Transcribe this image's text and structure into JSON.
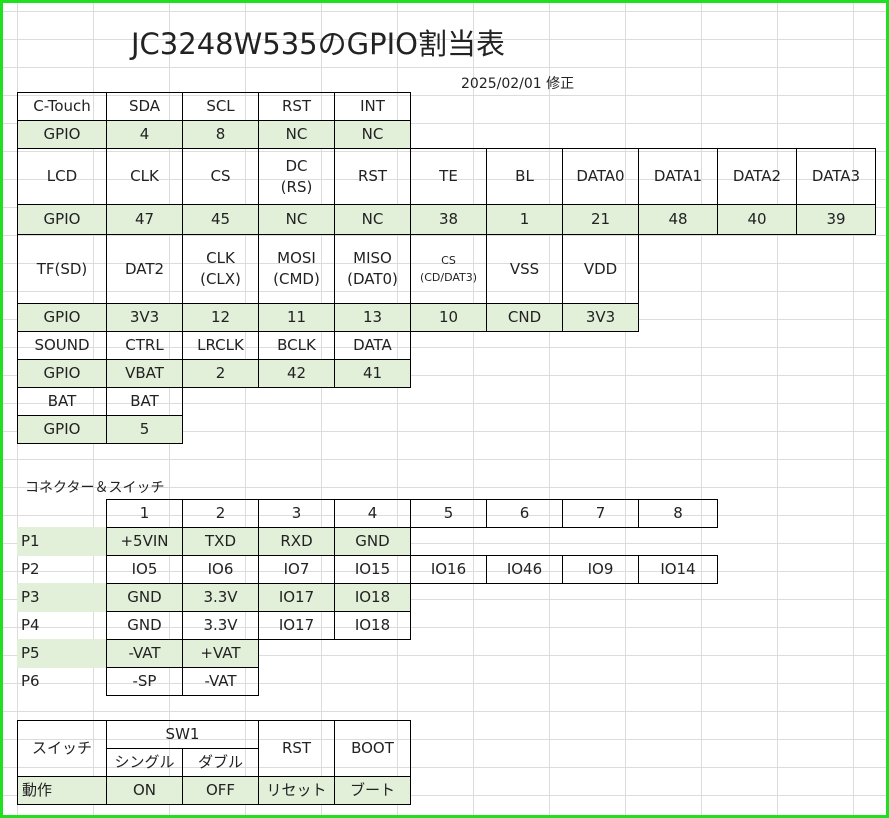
{
  "title": "JC3248W535のGPIO割当表",
  "date": "2025/02/01 修正",
  "touch": {
    "header": [
      "C-Touch",
      "SDA",
      "SCL",
      "RST",
      "INT"
    ],
    "gpio": [
      "GPIO",
      "4",
      "8",
      "NC",
      "NC"
    ]
  },
  "lcd": {
    "header": [
      "LCD",
      "CLK",
      "CS",
      "DC",
      "(RS)",
      "RST",
      "TE",
      "BL",
      "DATA0",
      "DATA1",
      "DATA2",
      "DATA3"
    ],
    "gpio": [
      "GPIO",
      "47",
      "45",
      "NC",
      "NC",
      "38",
      "1",
      "21",
      "48",
      "40",
      "39"
    ]
  },
  "tf": {
    "header": [
      "TF(SD)",
      "DAT2",
      "CLK",
      "(CLX)",
      "MOSI",
      "(CMD)",
      "MISO",
      "(DAT0)",
      "CS",
      "(CD/DAT3)",
      "VSS",
      "VDD"
    ],
    "gpio": [
      "GPIO",
      "3V3",
      "12",
      "11",
      "13",
      "10",
      "CND",
      "3V3"
    ]
  },
  "sound": {
    "header": [
      "SOUND",
      "CTRL",
      "LRCLK",
      "BCLK",
      "DATA"
    ],
    "gpio": [
      "GPIO",
      "VBAT",
      "2",
      "42",
      "41"
    ]
  },
  "bat": {
    "header": [
      "BAT",
      "BAT"
    ],
    "gpio": [
      "GPIO",
      "5"
    ]
  },
  "connector_label": "コネクター＆スイッチ",
  "connectors": {
    "numbers": [
      "1",
      "2",
      "3",
      "4",
      "5",
      "6",
      "7",
      "8"
    ],
    "rows": [
      {
        "name": "P1",
        "pins": [
          "+5VIN",
          "TXD",
          "RXD",
          "GND"
        ]
      },
      {
        "name": "P2",
        "pins": [
          "IO5",
          "IO6",
          "IO7",
          "IO15",
          "IO16",
          "IO46",
          "IO9",
          "IO14"
        ]
      },
      {
        "name": "P3",
        "pins": [
          "GND",
          "3.3V",
          "IO17",
          "IO18"
        ]
      },
      {
        "name": "P4",
        "pins": [
          "GND",
          "3.3V",
          "IO17",
          "IO18"
        ]
      },
      {
        "name": "P5",
        "pins": [
          "-VAT",
          "+VAT"
        ]
      },
      {
        "name": "P6",
        "pins": [
          "-SP",
          "-VAT"
        ]
      }
    ]
  },
  "switch": {
    "label": "スイッチ",
    "sw1": "SW1",
    "single": "シングル",
    "double": "ダブル",
    "rst": "RST",
    "boot": "BOOT",
    "action_label": "動作",
    "on": "ON",
    "off": "OFF",
    "reset": "リセット",
    "boot_action": "ブート"
  }
}
